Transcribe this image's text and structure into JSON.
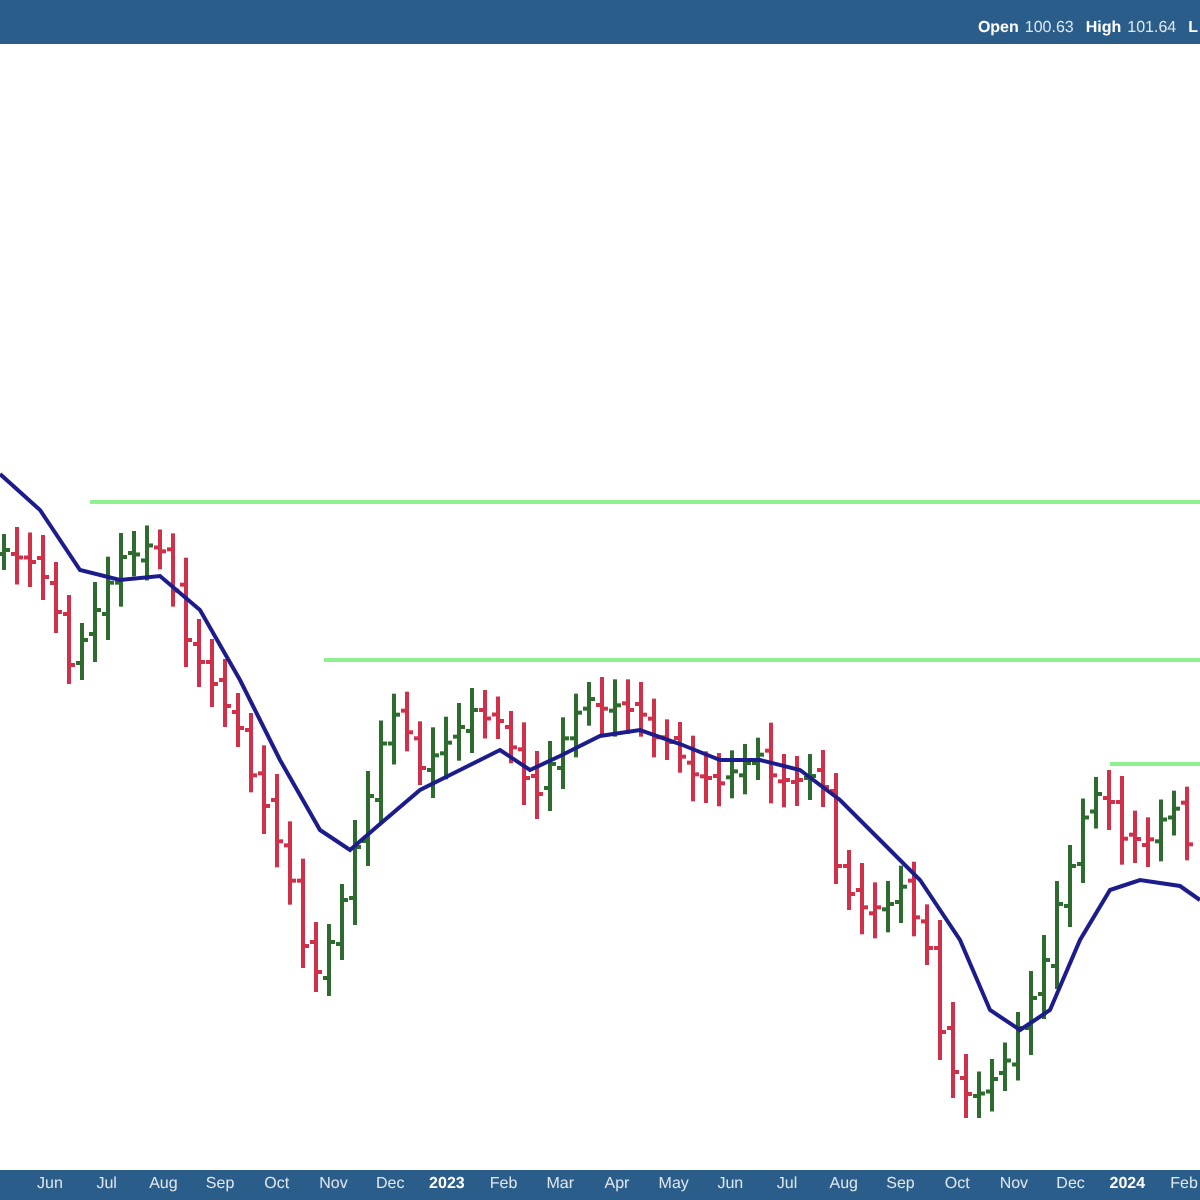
{
  "header": {
    "quote": [
      {
        "label": "Open",
        "value": "100.63"
      },
      {
        "label": "High",
        "value": "101.64"
      },
      {
        "label": "L"
      }
    ]
  },
  "time_axis": {
    "labels": [
      {
        "text": "Jun",
        "kind": "month"
      },
      {
        "text": "Jul",
        "kind": "month"
      },
      {
        "text": "Aug",
        "kind": "month"
      },
      {
        "text": "Sep",
        "kind": "month"
      },
      {
        "text": "Oct",
        "kind": "month"
      },
      {
        "text": "Nov",
        "kind": "month"
      },
      {
        "text": "Dec",
        "kind": "month"
      },
      {
        "text": "2023",
        "kind": "year"
      },
      {
        "text": "Feb",
        "kind": "month"
      },
      {
        "text": "Mar",
        "kind": "month"
      },
      {
        "text": "Apr",
        "kind": "month"
      },
      {
        "text": "May",
        "kind": "month"
      },
      {
        "text": "Jun",
        "kind": "month"
      },
      {
        "text": "Jul",
        "kind": "month"
      },
      {
        "text": "Aug",
        "kind": "month"
      },
      {
        "text": "Sep",
        "kind": "month"
      },
      {
        "text": "Oct",
        "kind": "month"
      },
      {
        "text": "Nov",
        "kind": "month"
      },
      {
        "text": "Dec",
        "kind": "month"
      },
      {
        "text": "2024",
        "kind": "year"
      },
      {
        "text": "Feb",
        "kind": "month"
      }
    ]
  }
}
